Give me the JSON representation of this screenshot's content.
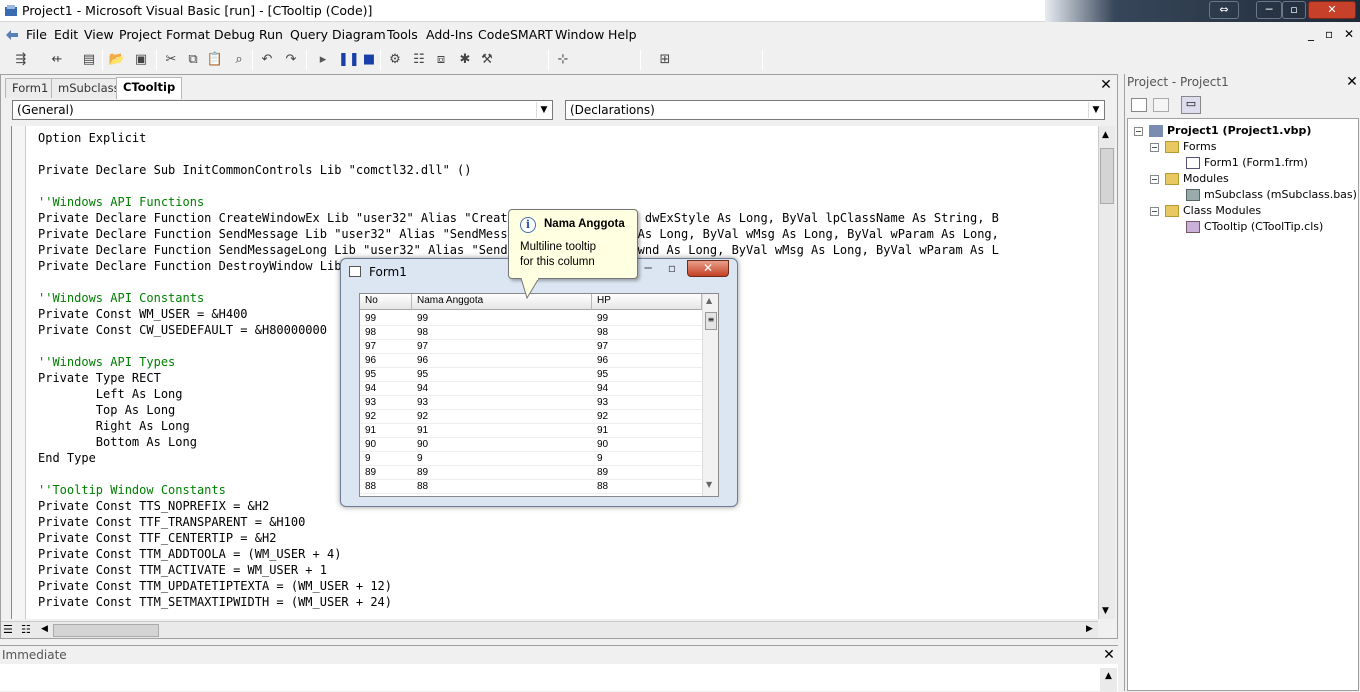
{
  "window": {
    "title": "Project1 - Microsoft Visual Basic [run] - [CTooltip (Code)]",
    "min_glyph": "─",
    "max_glyph": "▫",
    "close_glyph": "✕",
    "swap_glyph": "⇔"
  },
  "menu": [
    "File",
    "Edit",
    "View",
    "Project",
    "Format",
    "Debug",
    "Run",
    "Query",
    "Diagram",
    "Tools",
    "Add-Ins",
    "CodeSMART",
    "Window",
    "Help"
  ],
  "mdi_controls": {
    "min": "_",
    "restore": "▫",
    "close": "✕"
  },
  "tabs": [
    {
      "label": "Form1",
      "active": false
    },
    {
      "label": "mSubclass",
      "active": false
    },
    {
      "label": "CTooltip",
      "active": true
    }
  ],
  "object_combo": "(General)",
  "procedure_combo": "(Declarations)",
  "code_lines": [
    "Option Explicit",
    "",
    "Private Declare Sub InitCommonControls Lib \"comctl32.dll\" ()",
    "",
    "''Windows API Functions",
    "Private Declare Function CreateWindowEx Lib \"user32\" Alias \"CreateWindowExA\" (ByVal dwExStyle As Long, ByVal lpClassName As String, B",
    "Private Declare Function SendMessage Lib \"user32\" Alias \"SendMessageA\" (ByVal hwnd As Long, ByVal wMsg As Long, ByVal wParam As Long,",
    "Private Declare Function SendMessageLong Lib \"user32\" Alias \"SendMessageA\" (ByVal hwnd As Long, ByVal wMsg As Long, ByVal wParam As L",
    "Private Declare Function DestroyWindow Lib \"user32\" (ByVal hwnd As Long) As Long",
    "",
    "''Windows API Constants",
    "Private Const WM_USER = &H400",
    "Private Const CW_USEDEFAULT = &H80000000",
    "",
    "''Windows API Types",
    "Private Type RECT",
    "        Left As Long",
    "        Top As Long",
    "        Right As Long",
    "        Bottom As Long",
    "End Type",
    "",
    "''Tooltip Window Constants",
    "Private Const TTS_NOPREFIX = &H2",
    "Private Const TTF_TRANSPARENT = &H100",
    "Private Const TTF_CENTERTIP = &H2",
    "Private Const TTM_ADDTOOLA = (WM_USER + 4)",
    "Private Const TTM_ACTIVATE = WM_USER + 1",
    "Private Const TTM_UPDATETIPTEXTA = (WM_USER + 12)",
    "Private Const TTM_SETMAXTIPWIDTH = (WM_USER + 24)"
  ],
  "project_panel": {
    "title": "Project - Project1",
    "tree": {
      "root": "Project1 (Project1.vbp)",
      "forms_label": "Forms",
      "form1": "Form1 (Form1.frm)",
      "modules_label": "Modules",
      "msubclass": "mSubclass (mSubclass.bas)",
      "class_label": "Class Modules",
      "ctooltip": "CTooltip (CToolTip.cls)"
    }
  },
  "immediate": {
    "title": "Immediate"
  },
  "form1": {
    "title": "Form1",
    "columns": [
      "No",
      "Nama Anggota",
      "HP"
    ],
    "rows": [
      [
        "99",
        "99",
        "99"
      ],
      [
        "98",
        "98",
        "98"
      ],
      [
        "97",
        "97",
        "97"
      ],
      [
        "96",
        "96",
        "96"
      ],
      [
        "95",
        "95",
        "95"
      ],
      [
        "94",
        "94",
        "94"
      ],
      [
        "93",
        "93",
        "93"
      ],
      [
        "92",
        "92",
        "92"
      ],
      [
        "91",
        "91",
        "91"
      ],
      [
        "90",
        "90",
        "90"
      ],
      [
        "9",
        "9",
        "9"
      ],
      [
        "89",
        "89",
        "89"
      ],
      [
        "88",
        "88",
        "88"
      ]
    ]
  },
  "tooltip": {
    "title": "Nama Anggota",
    "body": "Multiline tooltip\nfor this column",
    "icon": "i"
  }
}
